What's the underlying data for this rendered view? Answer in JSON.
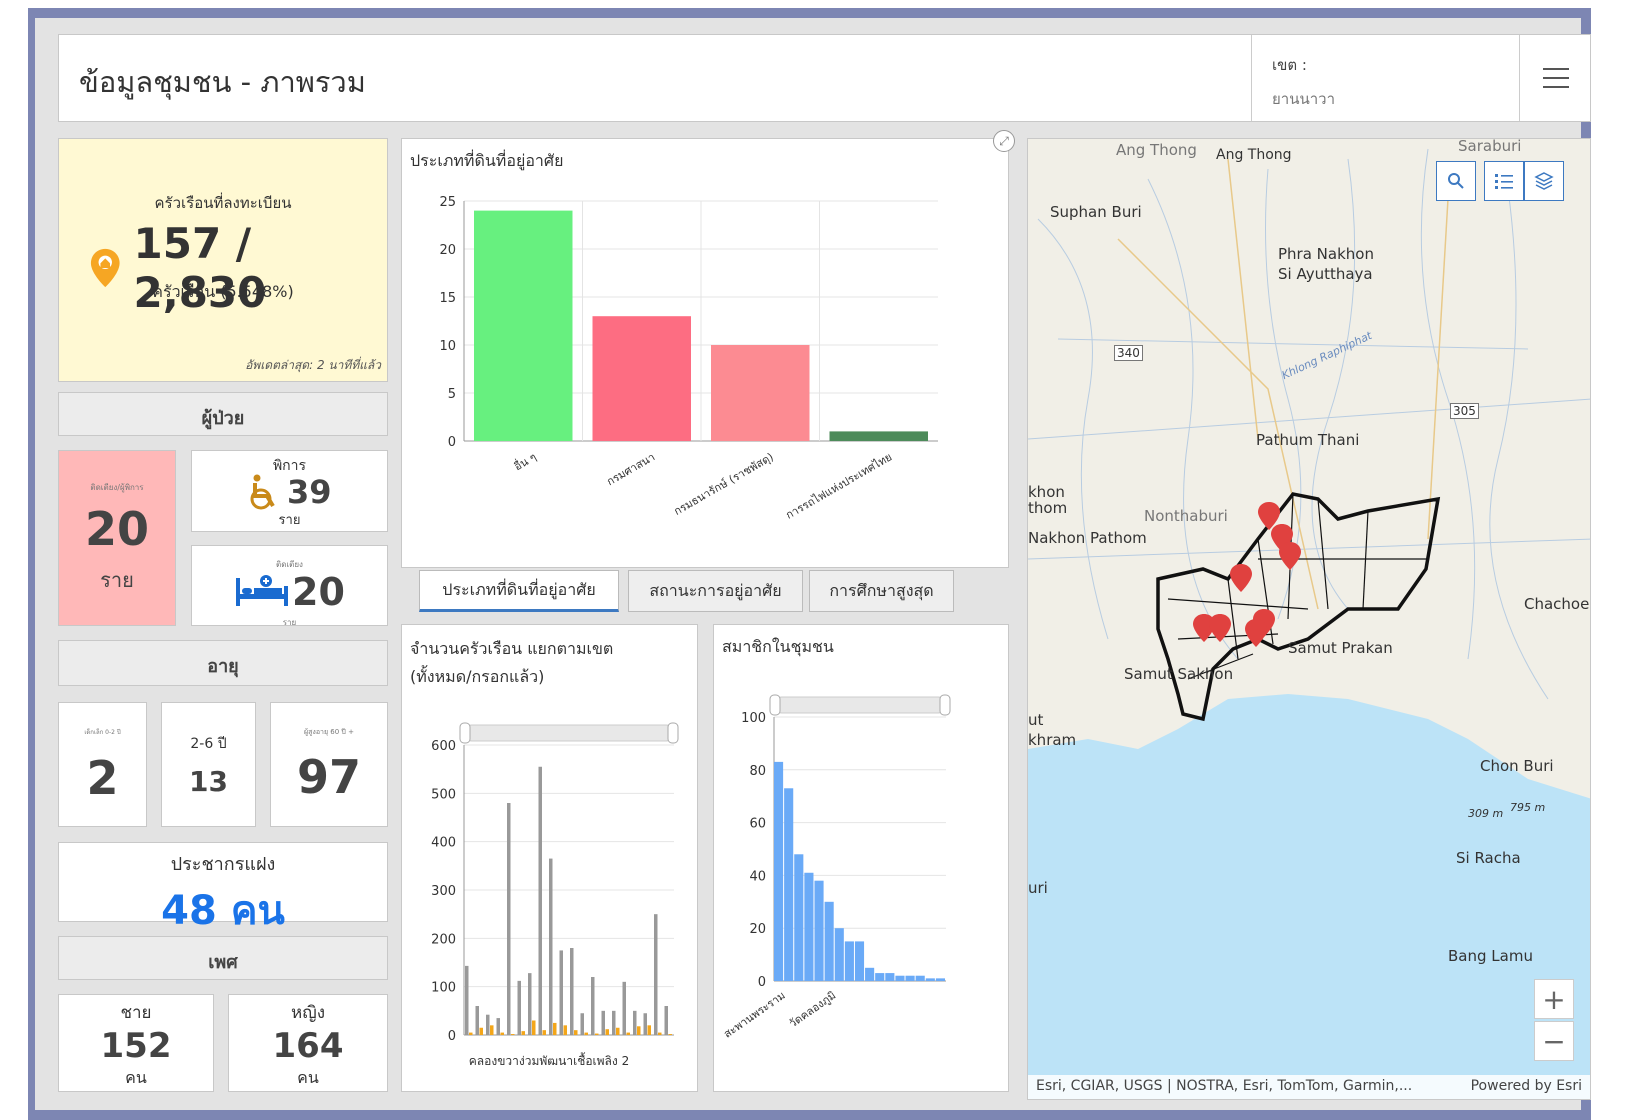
{
  "header": {
    "title": "ข้อมูลชุมชน - ภาพรวม",
    "selector_label": "เขต :",
    "selector_value": "ยานนาวา"
  },
  "household": {
    "label": "ครัวเรือนที่ลงทะเบียน",
    "value": "157 / 2,830",
    "sub": "ครัวเรือน (5.548%)",
    "updated": "อัพเดตล่าสุด: 2 นาทีที่แล้ว"
  },
  "patients": {
    "title": "ผู้ป่วย",
    "bed_social_label": "ติดเตียง/ผู้พิการ",
    "bed_social_value": "20",
    "bed_social_unit": "ราย",
    "disabled_label": "พิการ",
    "disabled_value": "39",
    "disabled_unit": "ราย",
    "bedridden_label": "ติดเตียง",
    "bedridden_value": "20",
    "bedridden_unit": "ราย"
  },
  "age": {
    "title": "อายุ",
    "g1_label": "เด็กเล็ก 0-2 ปี",
    "g1_value": "2",
    "g2_label": "2-6 ปี",
    "g2_value": "13",
    "g3_label": "ผู้สูงอายุ 60 ปี +",
    "g3_value": "97"
  },
  "hidden_pop": {
    "label": "ประชากรแฝง",
    "value": "48 คน"
  },
  "gender": {
    "title": "เพศ",
    "male_label": "ชาย",
    "male_value": "152",
    "male_unit": "คน",
    "female_label": "หญิง",
    "female_value": "164",
    "female_unit": "คน"
  },
  "land_chart": {
    "title": "ประเภทที่ดินที่อยู่อาศัย"
  },
  "tabs": [
    "ประเภทที่ดินที่อยู่อาศัย",
    "สถานะการอยู่อาศัย",
    "การศึกษาสูงสุด"
  ],
  "district_chart": {
    "title_line1": "จำนวนครัวเรือน แยกตามเขต",
    "title_line2": "(ทั้งหมด/กรอกแล้ว)"
  },
  "member_chart": {
    "title": "สมาชิกในชุมชน"
  },
  "chart_data": [
    {
      "type": "bar",
      "title": "ประเภทที่ดินที่อยู่อาศัย",
      "categories": [
        "อื่น ๆ",
        "กรมศาสนา",
        "กรมธนารักษ์ (ราชพัสดุ)",
        "การรถไฟแห่งประเทศไทย"
      ],
      "values": [
        24,
        13,
        10,
        1
      ],
      "colors": [
        "#67f07f",
        "#fd6d82",
        "#fc8b92",
        "#4d8b5a"
      ],
      "ylim": [
        0,
        25
      ],
      "yticks": [
        0,
        5,
        10,
        15,
        20,
        25
      ]
    },
    {
      "type": "bar",
      "title": "จำนวนครัวเรือน แยกตามเขต (ทั้งหมด/กรอกแล้ว)",
      "categories": [
        "คลองขวาง่วมพัฒนาเชื้อเพลิง 2"
      ],
      "series": [
        {
          "name": "ทั้งหมด",
          "color": "#999999",
          "values": [
            143,
            60,
            42,
            35,
            480,
            112,
            128,
            555,
            365,
            175,
            180,
            45,
            120,
            50,
            50,
            110,
            50,
            45,
            250,
            60
          ]
        },
        {
          "name": "กรอกแล้ว",
          "color": "#f3a61a",
          "values": [
            5,
            15,
            20,
            5,
            2,
            8,
            30,
            10,
            25,
            20,
            10,
            5,
            3,
            12,
            15,
            5,
            18,
            20,
            5,
            2
          ]
        }
      ],
      "ylim": [
        0,
        600
      ],
      "yticks": [
        0,
        100,
        200,
        300,
        400,
        500,
        600
      ]
    },
    {
      "type": "bar",
      "title": "สมาชิกในชุมชน",
      "categories": [
        "สะพานพระราม",
        "วัดคลองภูมิ"
      ],
      "values": [
        83,
        73,
        48,
        41,
        38,
        30,
        20,
        15,
        15,
        5,
        3,
        3,
        2,
        2,
        2,
        1,
        1
      ],
      "color": "#6aaaf7",
      "ylim": [
        0,
        100
      ],
      "yticks": [
        0,
        20,
        40,
        60,
        80,
        100
      ]
    }
  ],
  "map": {
    "labels": [
      "Ang Thong",
      "Ang Thong",
      "Saraburi",
      "Suphan Buri",
      "Phra Nakhon",
      "Si Ayutthaya",
      "340",
      "Khlong Raphiphat",
      "305",
      "Pathum Thani",
      "khon",
      "thom",
      "Nonthaburi",
      "Nakhon Pathom",
      "Chachoe",
      "Samut Prakan",
      "Samut Sakhon",
      "ut",
      "khram",
      "Chon Buri",
      "309 m",
      "795 m",
      "Si Racha",
      "uri",
      "Bang Lamu"
    ],
    "attribution": "Esri, CGIAR, USGS | NOSTRA, Esri, TomTom, Garmin,...",
    "powered": "Powered by Esri"
  }
}
